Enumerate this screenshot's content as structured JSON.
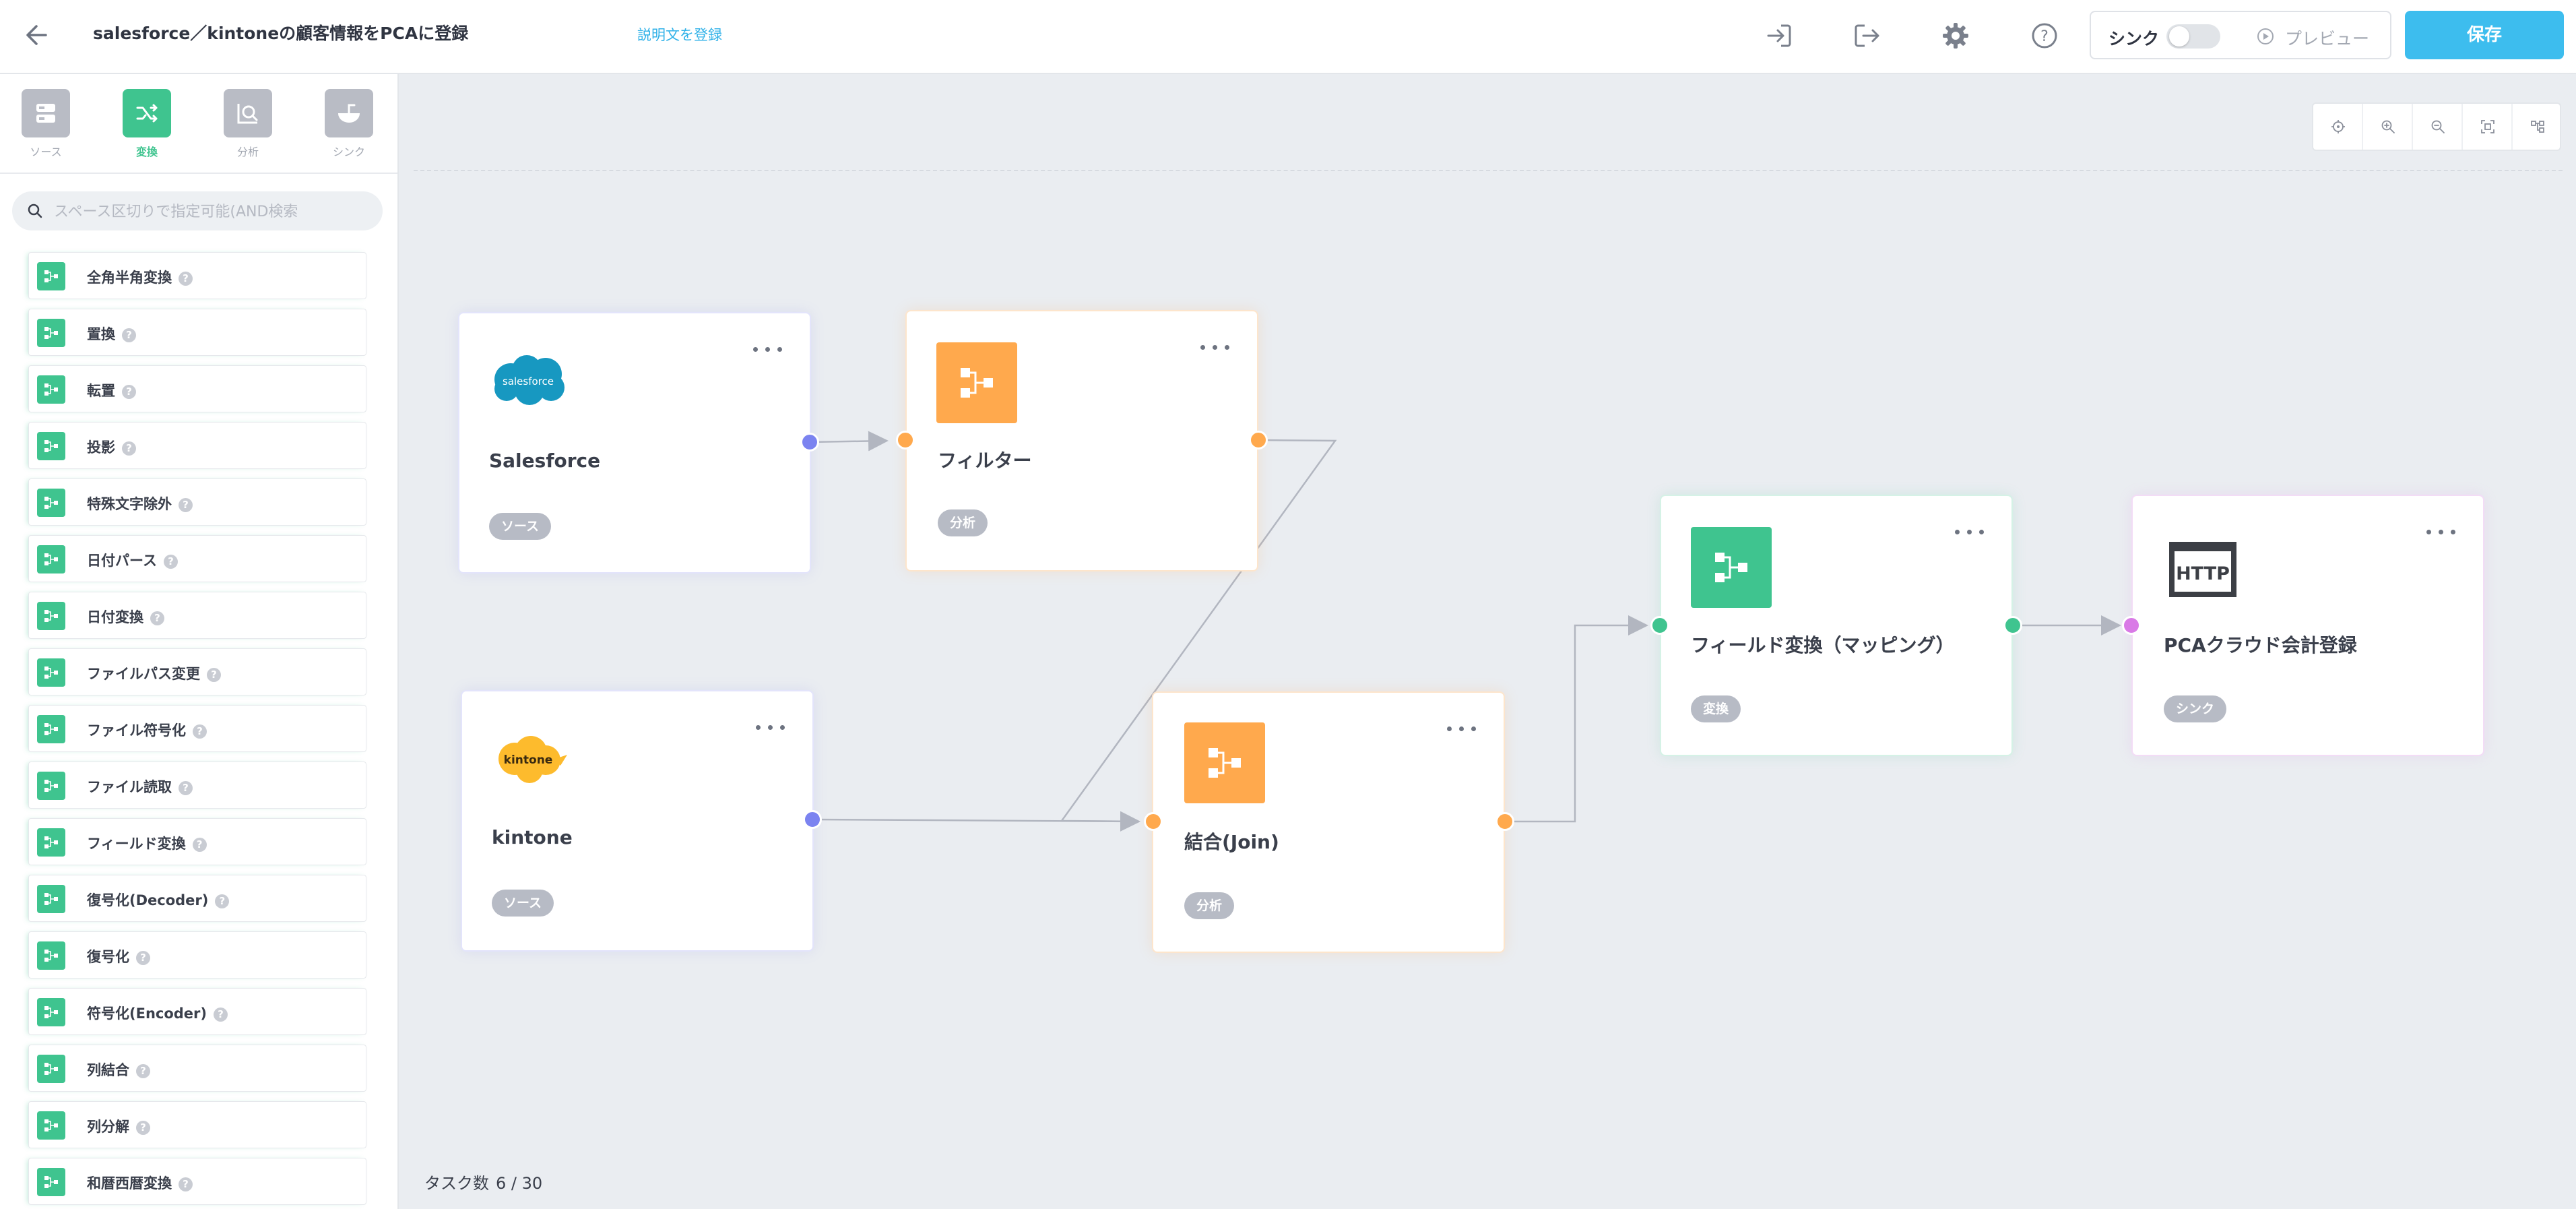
{
  "header": {
    "title": "salesforce／kintoneの顧客情報をPCAに登録",
    "description_link": "説明文を登録",
    "icons": [
      "import-icon",
      "export-icon",
      "gear-icon",
      "help-icon"
    ],
    "sync_label": "シンク",
    "sync_enabled": false,
    "preview_label": "プレビュー",
    "save_label": "保存"
  },
  "sidebar": {
    "categories": [
      {
        "label": "ソース",
        "icon": "database-icon",
        "active": false
      },
      {
        "label": "変換",
        "icon": "shuffle-icon",
        "active": true
      },
      {
        "label": "分析",
        "icon": "analyze-icon",
        "active": false
      },
      {
        "label": "シンク",
        "icon": "sink-icon",
        "active": false
      }
    ],
    "search_placeholder": "スペース区切りで指定可能(AND検索",
    "operations": [
      "全角半角変換",
      "置換",
      "転置",
      "投影",
      "特殊文字除外",
      "日付パース",
      "日付変換",
      "ファイルパス変更",
      "ファイル符号化",
      "ファイル読取",
      "フィールド変換",
      "復号化(Decoder)",
      "復号化",
      "符号化(Encoder)",
      "列結合",
      "列分解",
      "和暦西暦変換"
    ],
    "help_glyph": "?"
  },
  "canvas": {
    "tools": [
      "center-icon",
      "zoom-in-icon",
      "zoom-out-icon",
      "fit-icon",
      "layout-icon"
    ],
    "nodes": {
      "salesforce": {
        "title": "Salesforce",
        "badge": "ソース",
        "logo_text": "salesforce",
        "accent": "#7b83f0"
      },
      "filter": {
        "title": "フィルター",
        "badge": "分析",
        "accent": "#ffa94d"
      },
      "kintone": {
        "title": "kintone",
        "badge": "ソース",
        "logo_text": "kintone",
        "accent": "#7b83f0"
      },
      "join": {
        "title": "結合(Join)",
        "badge": "分析",
        "accent": "#ffa94d"
      },
      "mapping": {
        "title": "フィールド変換（マッピング）",
        "badge": "変換",
        "accent": "#3fc48f"
      },
      "pca": {
        "title": "PCAクラウド会計登録",
        "badge": "シンク",
        "logo_text": "HTTP",
        "accent": "#d97ae6"
      }
    },
    "task_label": "タスク数",
    "task_count": "6 / 30"
  }
}
